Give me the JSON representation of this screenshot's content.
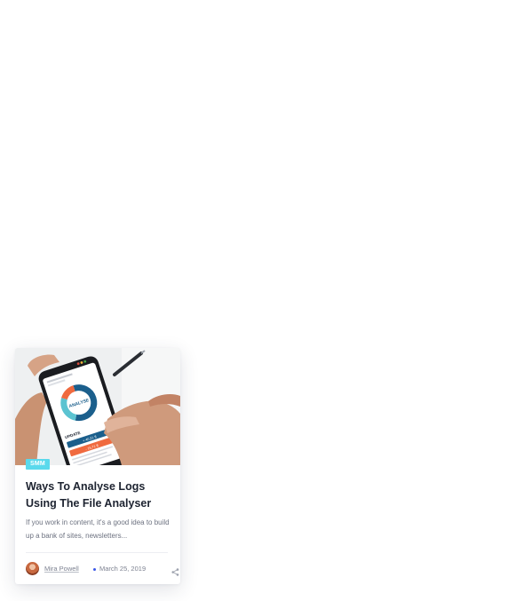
{
  "post": {
    "category": "SMM",
    "title": "Ways To Analyse Logs Using The File Analyser",
    "excerpt": "If you work in content, it's a good idea to build up a bank of sites, newsletters...",
    "author": "Mira Powell",
    "date": "March 25, 2019",
    "image": {
      "screen_label": "ANALYSE",
      "update_label": "UPDATE",
      "pill_blue": "+ 40,21 $",
      "pill_orange": "- 15,71 $"
    }
  },
  "colors": {
    "badge": "#5ad9ec",
    "title": "#1d2330",
    "meta_dot": "#3a57e8",
    "donut_blue": "#1b5f8c",
    "donut_teal": "#5bc3d1",
    "donut_orange": "#f06a3f"
  }
}
